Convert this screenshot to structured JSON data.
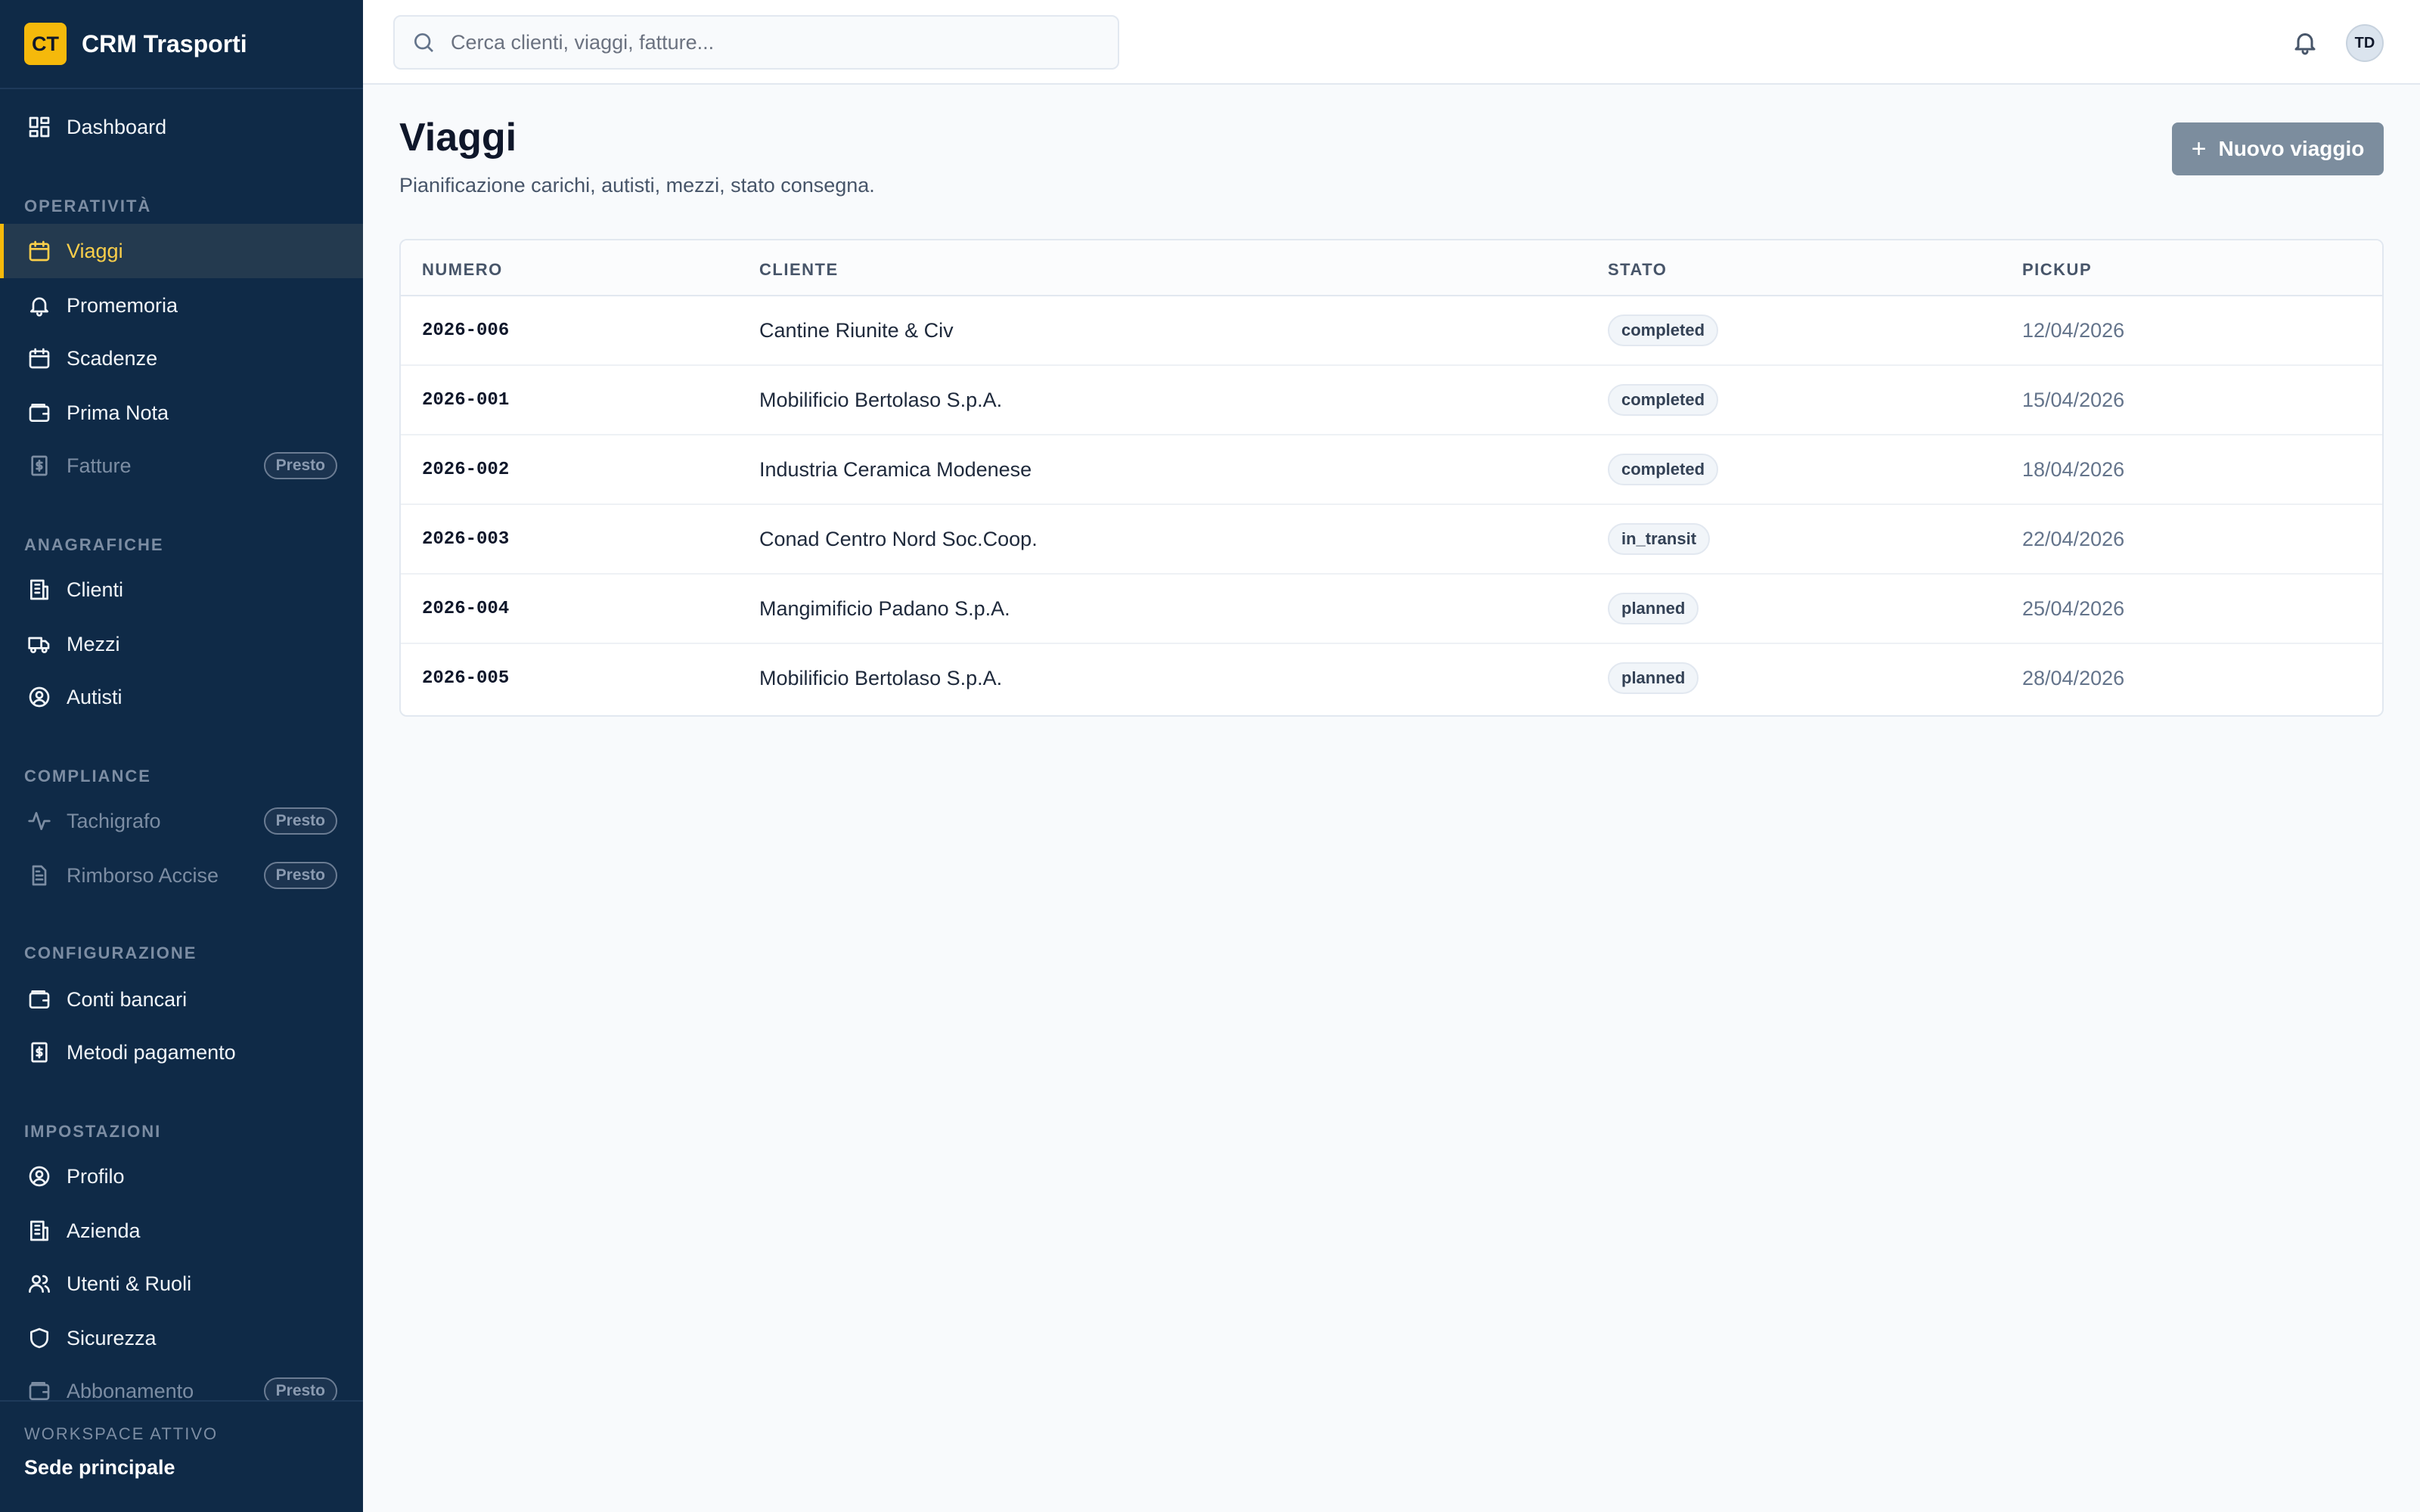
{
  "app": {
    "logo_initials": "CT",
    "name": "CRM Trasporti"
  },
  "sidebar": {
    "dashboard": "Dashboard",
    "sections": {
      "operativita": "OPERATIVITÀ",
      "anagrafiche": "ANAGRAFICHE",
      "compliance": "COMPLIANCE",
      "configurazione": "CONFIGURAZIONE",
      "impostazioni": "IMPOSTAZIONI"
    },
    "items": {
      "viaggi": "Viaggi",
      "promemoria": "Promemoria",
      "scadenze": "Scadenze",
      "prima_nota": "Prima Nota",
      "fatture": "Fatture",
      "clienti": "Clienti",
      "mezzi": "Mezzi",
      "autisti": "Autisti",
      "tachigrafo": "Tachigrafo",
      "rimborso_accise": "Rimborso Accise",
      "conti_bancari": "Conti bancari",
      "metodi_pagamento": "Metodi pagamento",
      "profilo": "Profilo",
      "azienda": "Azienda",
      "utenti_ruoli": "Utenti & Ruoli",
      "sicurezza": "Sicurezza",
      "abbonamento": "Abbonamento"
    },
    "badge_presto": "Presto",
    "workspace": {
      "label": "WORKSPACE ATTIVO",
      "value": "Sede principale"
    }
  },
  "topbar": {
    "search_placeholder": "Cerca clienti, viaggi, fatture...",
    "user_initials": "TD"
  },
  "page": {
    "title": "Viaggi",
    "subtitle": "Pianificazione carichi, autisti, mezzi, stato consegna.",
    "new_button": "Nuovo viaggio"
  },
  "table": {
    "headers": {
      "numero": "NUMERO",
      "cliente": "CLIENTE",
      "stato": "STATO",
      "pickup": "PICKUP"
    },
    "rows": [
      {
        "numero": "2026-006",
        "cliente": "Cantine Riunite & Civ",
        "stato": "completed",
        "pickup": "12/04/2026"
      },
      {
        "numero": "2026-001",
        "cliente": "Mobilificio Bertolaso S.p.A.",
        "stato": "completed",
        "pickup": "15/04/2026"
      },
      {
        "numero": "2026-002",
        "cliente": "Industria Ceramica Modenese",
        "stato": "completed",
        "pickup": "18/04/2026"
      },
      {
        "numero": "2026-003",
        "cliente": "Conad Centro Nord Soc.Coop.",
        "stato": "in_transit",
        "pickup": "22/04/2026"
      },
      {
        "numero": "2026-004",
        "cliente": "Mangimificio Padano S.p.A.",
        "stato": "planned",
        "pickup": "25/04/2026"
      },
      {
        "numero": "2026-005",
        "cliente": "Mobilificio Bertolaso S.p.A.",
        "stato": "planned",
        "pickup": "28/04/2026"
      }
    ]
  },
  "colors": {
    "sidebar_bg": "#0f2a47",
    "accent": "#f5b90b",
    "button_bg": "#7c8d9e"
  }
}
